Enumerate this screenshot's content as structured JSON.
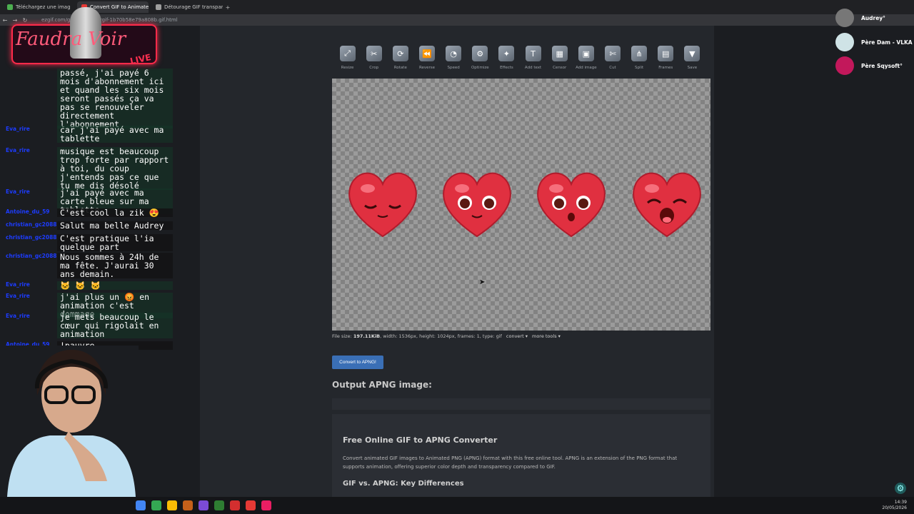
{
  "browser": {
    "tabs": [
      {
        "label": "Téléchargez une imag",
        "active": false
      },
      {
        "label": "Convert GIF to Animated",
        "active": true
      },
      {
        "label": "Détourage GIF transparent",
        "active": false
      }
    ],
    "url": "ezgif.com/gif-to-apng/ezgif-1b70b58e79a808b.gif.html"
  },
  "toolbar": {
    "tools": [
      {
        "label": "Resize",
        "icon": "resize-icon"
      },
      {
        "label": "Crop",
        "icon": "crop-icon"
      },
      {
        "label": "Rotate",
        "icon": "rotate-icon"
      },
      {
        "label": "Reverse",
        "icon": "reverse-icon"
      },
      {
        "label": "Speed",
        "icon": "speed-icon"
      },
      {
        "label": "Optimize",
        "icon": "optimize-icon"
      },
      {
        "label": "Effects",
        "icon": "effects-icon"
      },
      {
        "label": "Add text",
        "icon": "add-text-icon"
      },
      {
        "label": "Censor",
        "icon": "censor-icon"
      },
      {
        "label": "Add image",
        "icon": "add-image-icon"
      },
      {
        "label": "Cut",
        "icon": "cut-icon"
      },
      {
        "label": "Split",
        "icon": "split-icon"
      },
      {
        "label": "Frames",
        "icon": "frames-icon"
      },
      {
        "label": "Save",
        "icon": "save-icon"
      }
    ]
  },
  "fileinfo": {
    "prefix": "File size:",
    "size": "197.11KiB",
    "rest": ", width: 1536px, height: 1024px, frames: 1, type: gif",
    "convert": "convert ▾",
    "more": "more tools ▾"
  },
  "convert_button": "Convert to APNG!",
  "output_title": "Output APNG image:",
  "info": {
    "heading": "Free Online GIF to APNG Converter",
    "paragraph": "Convert animated GIF images to Animated PNG (APNG) format with this free online tool. APNG is an extension of the PNG format that supports animation, offering superior color depth and transparency compared to GIF.",
    "subheading": "GIF vs. APNG: Key Differences"
  },
  "viewers": [
    {
      "name": "Audrey°"
    },
    {
      "name": "Père Dam - VLKA Hj"
    },
    {
      "name": "Père Sqysoft°"
    }
  ],
  "logo": {
    "title": "Faudra Voir",
    "badge": "LIVE"
  },
  "chat": [
    {
      "user": "",
      "text": "passé, j'ai payé 6 mois d'abonnement ici et quand les six mois seront passés ça va pas se renouveler directement l'abonnement"
    },
    {
      "user": "Eva_rire",
      "text": "car j'ai payé avec ma tablette"
    },
    {
      "user": "Eva_rire",
      "text": "musique est beaucoup trop forte par rapport à toi, du coup j'entends pas ce que tu me dis désolé"
    },
    {
      "user": "Eva_rire",
      "text": "j'ai payé avec ma carte bleue sur ma tablette"
    },
    {
      "user": "Antoine_du_59",
      "text": "C'est cool la zik 😍"
    },
    {
      "user": "christian_gc2088",
      "text": "Salut ma belle Audrey"
    },
    {
      "user": "christian_gc2088",
      "text": "C'est pratique l'ia quelque part"
    },
    {
      "user": "christian_gc2088",
      "text": "Nous sommes à 24h de ma fête. J'aurai 30 ans demain."
    },
    {
      "user": "Eva_rire",
      "text": "🐱 🐱 🐱"
    },
    {
      "user": "Eva_rire",
      "text": "j'ai plus un 😡 en animation c'est dommage"
    },
    {
      "user": "Eva_rire",
      "text": "je mets beaucoup le cœur qui rigolait en animation"
    },
    {
      "user": "Antoine_du_59",
      "text": "!pauvre"
    }
  ],
  "clock": {
    "time": "14:39",
    "date": "20/05/2026"
  },
  "colors": {
    "accent": "#3a6fb6",
    "heart": "#e03040",
    "logo": "#ff2a4a"
  }
}
